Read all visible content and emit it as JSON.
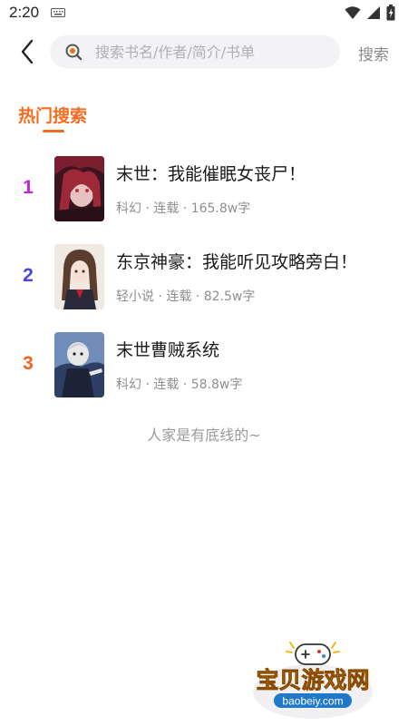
{
  "status_bar": {
    "time": "2:20"
  },
  "search": {
    "placeholder": "搜索书名/作者/简介/书单",
    "button_label": "搜索"
  },
  "section": {
    "title": "热门搜索"
  },
  "books": [
    {
      "rank": "1",
      "rank_color": "#c81ee0",
      "title": "末世：我能催眠女丧尸！",
      "meta": "科幻 · 连载 · 165.8w字"
    },
    {
      "rank": "2",
      "rank_color": "#4b45d6",
      "title": "东京神豪：我能听见攻略旁白！",
      "meta": "轻小说 · 连载 · 82.5w字"
    },
    {
      "rank": "3",
      "rank_color": "#f0641e",
      "title": "末世曹贼系统",
      "meta": "科幻 · 连载 · 58.8w字"
    }
  ],
  "end_message": "人家是有底线的~",
  "watermark": {
    "name": "宝贝游戏网",
    "url": "baobeiy.com"
  },
  "colors": {
    "accent": "#f26d1f",
    "search_bg": "#f3f3f5"
  }
}
